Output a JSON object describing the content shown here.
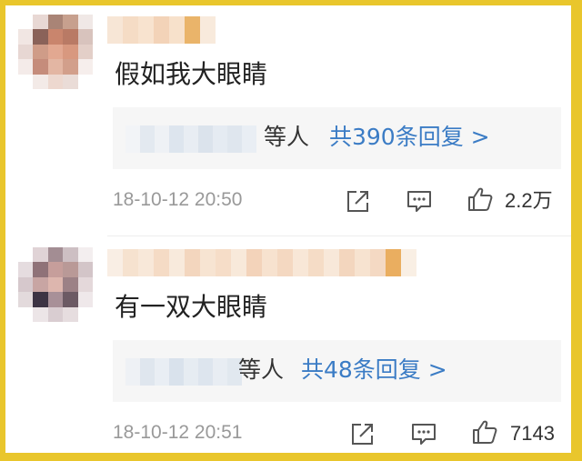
{
  "comments": [
    {
      "text": "假如我大眼睛",
      "reply_suffix": "等人",
      "reply_link": "共390条回复 >",
      "timestamp": "18-10-12 20:50",
      "likes": "2.2万",
      "icons": [
        "share-icon",
        "comment-icon",
        "like-icon"
      ]
    },
    {
      "text": "有一双大眼睛",
      "reply_suffix": "等人",
      "reply_link": "共48条回复 >",
      "timestamp": "18-10-12 20:51",
      "likes": "7143",
      "icons": [
        "share-icon",
        "comment-icon",
        "like-icon"
      ]
    }
  ],
  "colors": {
    "frame": "#e9c62c",
    "link": "#3b7cc5",
    "meta": "#999999",
    "reply_bg": "#f6f6f6"
  }
}
